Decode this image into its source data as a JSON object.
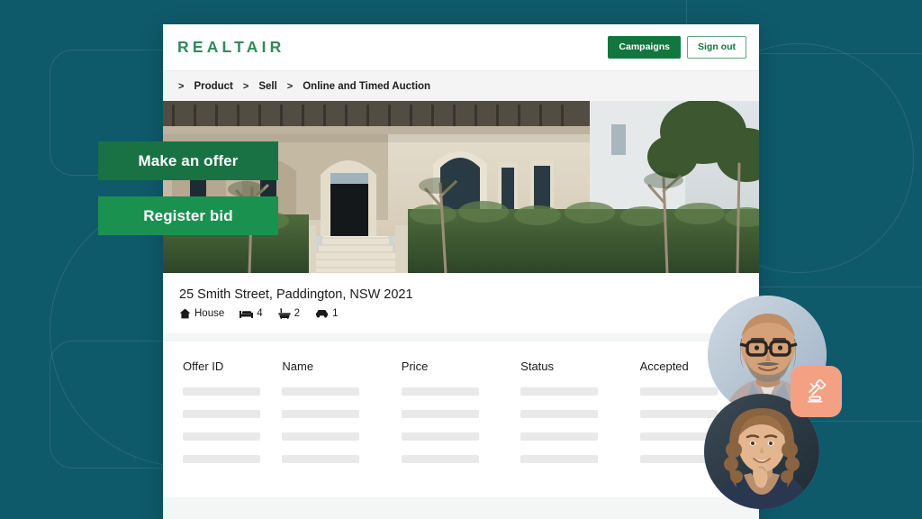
{
  "theme": {
    "page_background": "#0e5a6b",
    "brand_green": "#2f8a5b",
    "cta_green_dark": "#197244",
    "cta_green_light": "#1b9150",
    "badge_coral": "#f4a183",
    "skeleton_gray": "#e9e9e9"
  },
  "topbar": {
    "logo": "REALTAIR",
    "campaigns_label": "Campaigns",
    "signout_label": "Sign out"
  },
  "breadcrumb": {
    "separator": ">",
    "items": [
      {
        "label": "Product"
      },
      {
        "label": "Sell"
      },
      {
        "label": "Online and Timed Auction"
      }
    ]
  },
  "cta": {
    "make_offer_label": "Make an offer",
    "register_bid_label": "Register bid"
  },
  "property": {
    "address": "25 Smith Street, Paddington, NSW 2021",
    "specs": [
      {
        "icon": "house-icon",
        "value": "House"
      },
      {
        "icon": "bed-icon",
        "value": "4"
      },
      {
        "icon": "bath-icon",
        "value": "2"
      },
      {
        "icon": "car-icon",
        "value": "1"
      }
    ]
  },
  "offers_table": {
    "columns": [
      "Offer ID",
      "Name",
      "Price",
      "Status",
      "Accepted"
    ],
    "rows": [
      [
        "",
        "",
        "",
        "",
        ""
      ],
      [
        "",
        "",
        "",
        "",
        ""
      ],
      [
        "",
        "",
        "",
        "",
        ""
      ],
      [
        "",
        "",
        "",
        "",
        ""
      ]
    ]
  },
  "badge": {
    "icon": "gavel-icon"
  },
  "avatars": [
    {
      "name": "agent-avatar-top"
    },
    {
      "name": "agent-avatar-bottom"
    }
  ]
}
